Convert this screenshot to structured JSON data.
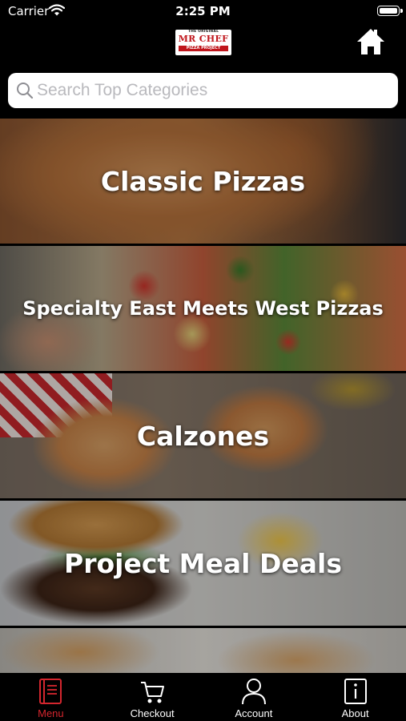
{
  "status_bar": {
    "carrier": "Carrier",
    "time": "2:25 PM",
    "battery": "full"
  },
  "header": {
    "logo": {
      "line1": "THE ORIGINAL",
      "line2": "MR CHEF",
      "line3": "PIZZA PROJECT"
    },
    "home_icon": "home-icon"
  },
  "search": {
    "placeholder": "Search Top Categories",
    "value": ""
  },
  "categories": [
    {
      "label": "Classic Pizzas"
    },
    {
      "label": "Specialty East Meets West Pizzas"
    },
    {
      "label": "Calzones"
    },
    {
      "label": "Project Meal Deals"
    },
    {
      "label": ""
    }
  ],
  "tabbar": {
    "active_color": "#d4262e",
    "tabs": [
      {
        "label": "Menu",
        "icon": "menu-book-icon",
        "active": true
      },
      {
        "label": "Checkout",
        "icon": "cart-icon",
        "active": false
      },
      {
        "label": "Account",
        "icon": "user-icon",
        "active": false
      },
      {
        "label": "About",
        "icon": "info-icon",
        "active": false
      }
    ]
  }
}
